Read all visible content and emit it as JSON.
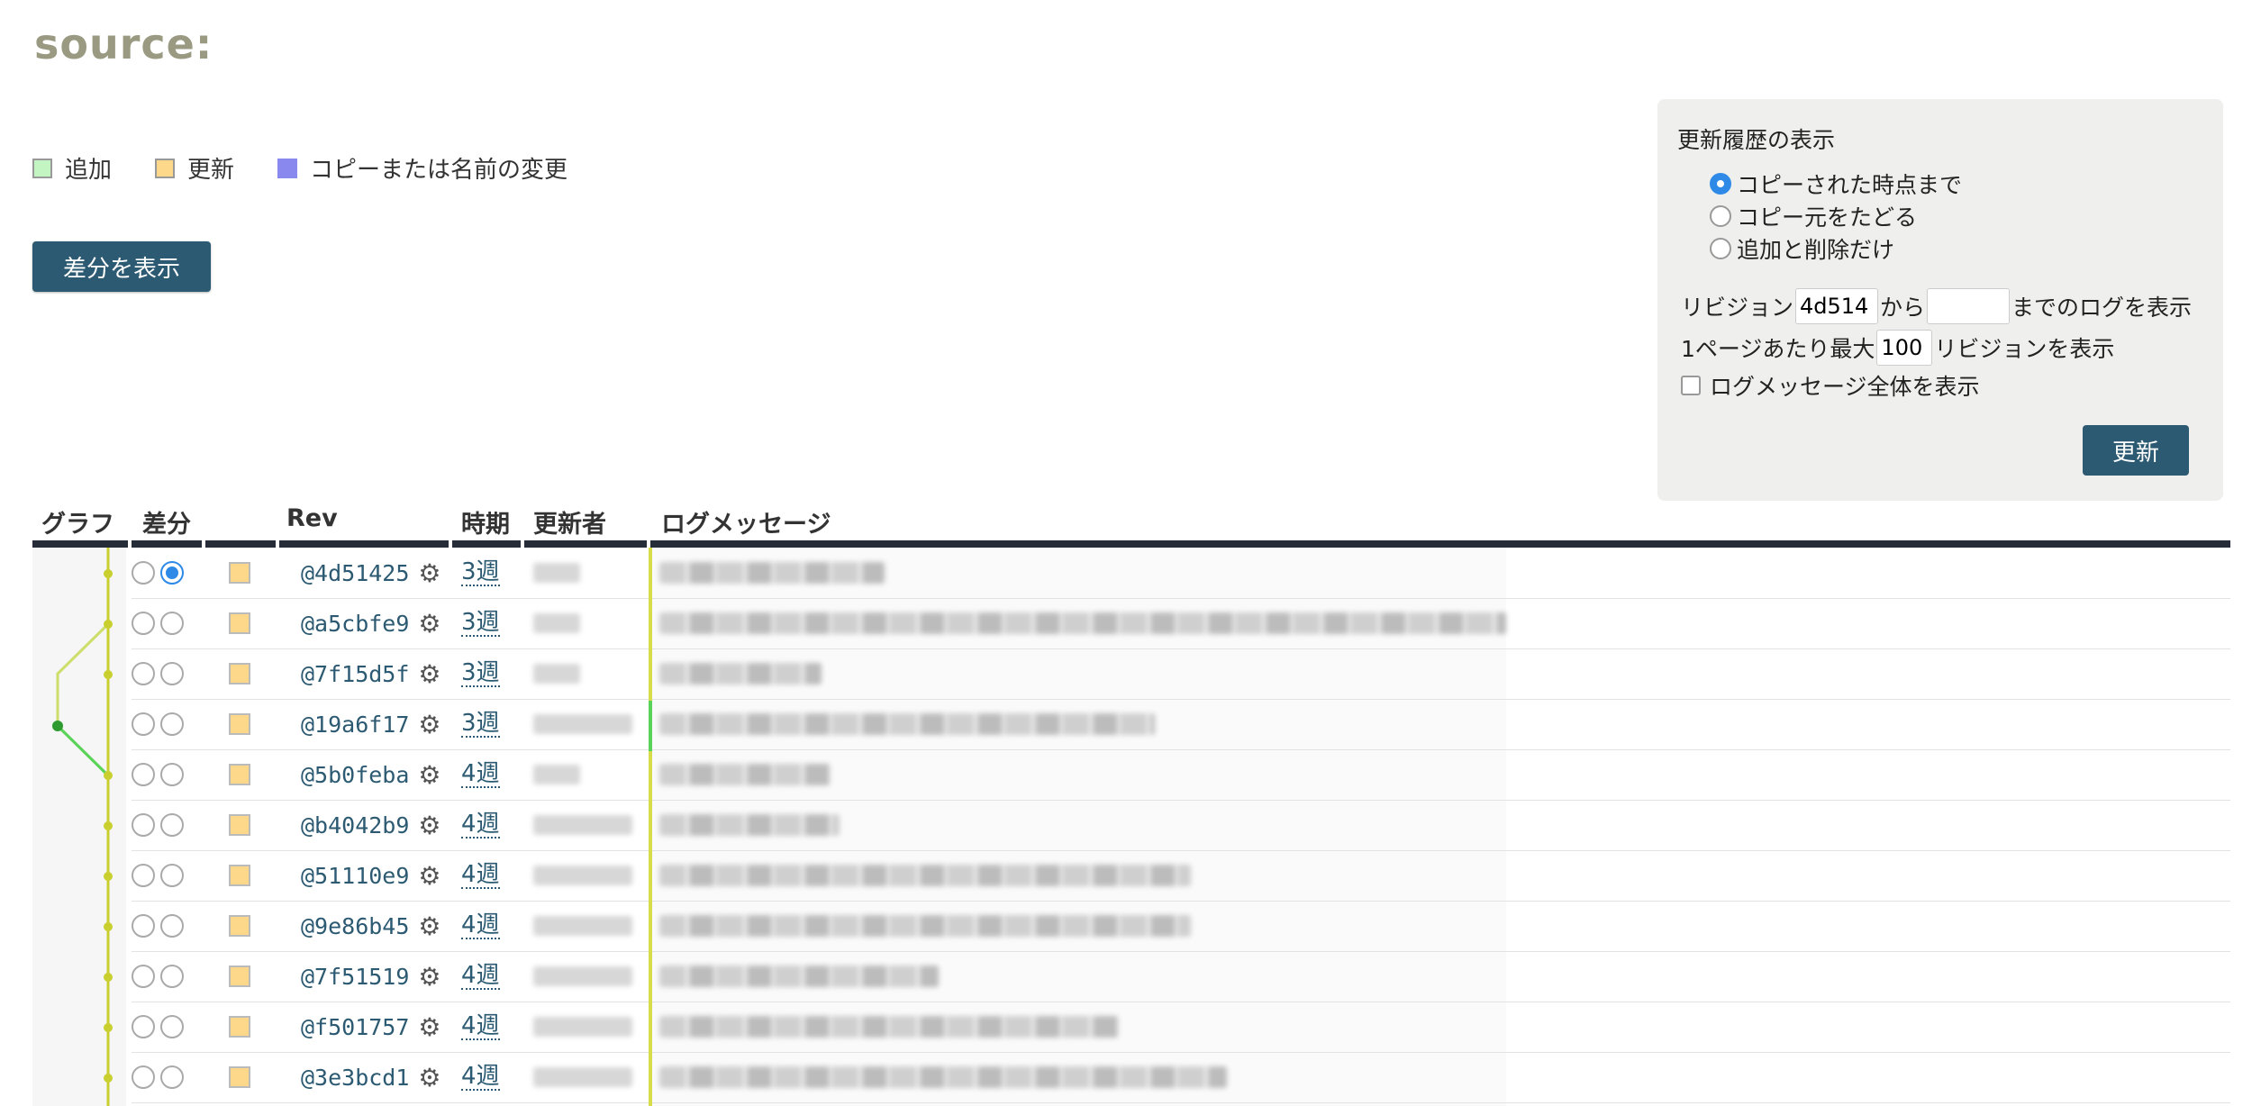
{
  "page": {
    "title": "source:"
  },
  "legend": [
    {
      "label": "追加",
      "color": "#c2f5c2"
    },
    {
      "label": "更新",
      "color": "#fdd88a"
    },
    {
      "label": "コピーまたは名前の変更",
      "color": "#8888ee"
    }
  ],
  "diff_button": "差分を表示",
  "panel": {
    "title": "更新履歴の表示",
    "options": [
      {
        "label": "コピーされた時点まで",
        "selected": true
      },
      {
        "label": "コピー元をたどる",
        "selected": false
      },
      {
        "label": "追加と削除だけ",
        "selected": false
      }
    ],
    "rev_prefix": "リビジョン",
    "rev_from_value": "4d514",
    "rev_from_suffix": "から",
    "rev_to_value": "",
    "rev_to_suffix": "までのログを表示",
    "per_page_prefix": "1ページあたり最大",
    "per_page_value": "100",
    "per_page_suffix": "リビジョンを表示",
    "full_message_label": "ログメッセージ全体を表示",
    "update_button": "更新"
  },
  "table": {
    "headers": {
      "graph": "グラフ",
      "diff": "差分",
      "rev": "Rev",
      "age": "時期",
      "author": "更新者",
      "message": "ログメッセージ"
    },
    "rows": [
      {
        "rev": "@4d51425",
        "age": "3週",
        "selected": true
      },
      {
        "rev": "@a5cbfe9",
        "age": "3週",
        "selected": false
      },
      {
        "rev": "@7f15d5f",
        "age": "3週",
        "selected": false
      },
      {
        "rev": "@19a6f17",
        "age": "3週",
        "selected": false
      },
      {
        "rev": "@5b0feba",
        "age": "4週",
        "selected": false
      },
      {
        "rev": "@b4042b9",
        "age": "4週",
        "selected": false
      },
      {
        "rev": "@51110e9",
        "age": "4週",
        "selected": false
      },
      {
        "rev": "@9e86b45",
        "age": "4週",
        "selected": false
      },
      {
        "rev": "@7f51519",
        "age": "4週",
        "selected": false
      },
      {
        "rev": "@f501757",
        "age": "4週",
        "selected": false
      },
      {
        "rev": "@3e3bcd1",
        "age": "4週",
        "selected": false
      }
    ]
  },
  "colors": {
    "accent": "#2c5a72",
    "graph_main": "#c8cf2e",
    "graph_branch": "#5ad35a"
  }
}
